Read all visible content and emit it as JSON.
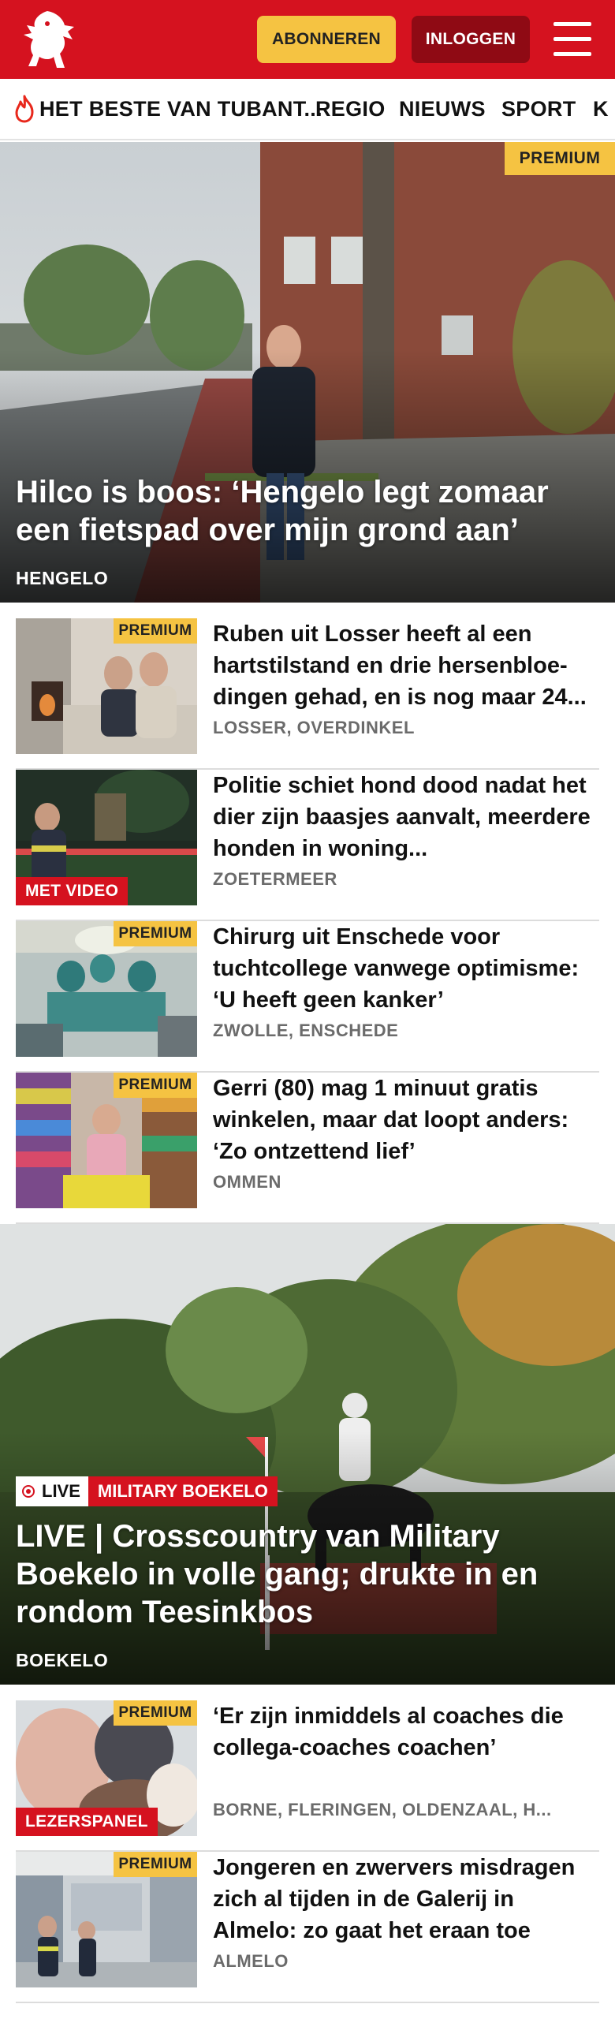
{
  "header": {
    "logo": "tubantia-horse-icon",
    "subscribe_label": "ABONNEREN",
    "login_label": "INLOGGEN",
    "menu_icon": "hamburger-icon",
    "brand_color": "#d5121f"
  },
  "nav": {
    "items": [
      {
        "label": "HET BESTE VAN TUBANT...",
        "icon": "flame-icon"
      },
      {
        "label": "REGIO"
      },
      {
        "label": "NIEUWS"
      },
      {
        "label": "SPORT"
      },
      {
        "label": "K"
      }
    ]
  },
  "hero1": {
    "badge": "PREMIUM",
    "title": "Hilco is boos: ‘Hengelo legt zomaar een fietspad over mijn grond aan’",
    "location": "HENGELO"
  },
  "articles": [
    {
      "badge": "PREMIUM",
      "title": "Ruben uit Losser heeft al een hartstilstand en drie hersenbloe-dingen gehad, en is nog maar 24...",
      "location": "LOSSER, OVERDINKEL"
    },
    {
      "tag": "MET VIDEO",
      "title": "Politie schiet hond dood nadat het dier zijn baasjes aanvalt, meerdere honden in woning...",
      "location": "ZOETERMEER"
    },
    {
      "badge": "PREMIUM",
      "title": "Chirurg uit Enschede voor tuchtcollege vanwege optimisme: ‘U heeft geen kanker’",
      "location": "ZWOLLE, ENSCHEDE"
    },
    {
      "badge": "PREMIUM",
      "title": "Gerri (80) mag 1 minuut gratis winkelen, maar dat loopt anders: ‘Zo ontzettend lief’",
      "location": "OMMEN"
    }
  ],
  "hero2": {
    "live_label": "LIVE",
    "live_tag": "MILITARY BOEKELO",
    "title": "LIVE | Crosscountry van Military Boekelo in volle gang; drukte in en rondom Teesinkbos",
    "location": "BOEKELO"
  },
  "articles2": [
    {
      "badge": "PREMIUM",
      "tag": "LEZERSPANEL",
      "title": "‘Er zijn inmiddels al coaches die collega-coaches coachen’",
      "location": "BORNE, FLERINGEN, OLDENZAAL, H..."
    },
    {
      "badge": "PREMIUM",
      "title": "Jongeren en zwervers misdragen zich al tijden in de Galerij in Almelo: zo gaat het eraan toe",
      "location": "ALMELO"
    }
  ]
}
